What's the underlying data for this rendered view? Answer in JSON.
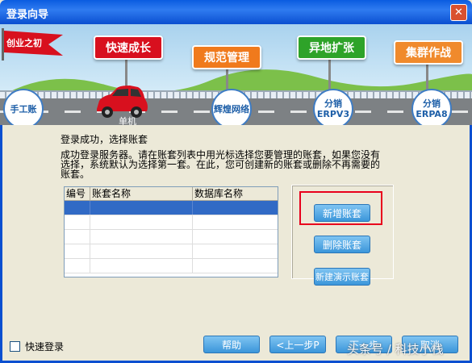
{
  "window": {
    "title": "登录向导"
  },
  "banner": {
    "flag": "创业之初",
    "stage1": "快速成长",
    "stage2": "规范管理",
    "stage3": "异地扩张",
    "stage4": "集群作战",
    "milestone1": "手工账",
    "car_label": "单机",
    "milestone2": "辉煌网络",
    "milestone3": "分销ERPV3",
    "milestone4": "分销ERPA8",
    "colors": {
      "stage1": "#D8101E",
      "stage2": "#F07A1C",
      "stage3": "#2EA329",
      "stage4": "#F08A2C"
    }
  },
  "content": {
    "success_text": "登录成功，选择账套",
    "description": "成功登录服务器。请在账套列表中用光标选择您要管理的账套，如果您没有选择，系统默认为选择第一套。在此，您可创建新的账套或删除不再需要的账套。",
    "table": {
      "columns": [
        "编号",
        "账套名称",
        "数据库名称"
      ],
      "rows": []
    },
    "buttons": {
      "add": "新增账套",
      "delete": "删除账套",
      "demo": "新建演示账套"
    }
  },
  "footer": {
    "quick_login": "快速登录",
    "help": "帮助",
    "prev": "<上一步P",
    "next": "下一步",
    "cancel": "取消",
    "watermark": "头条号 / 科技小栈"
  }
}
